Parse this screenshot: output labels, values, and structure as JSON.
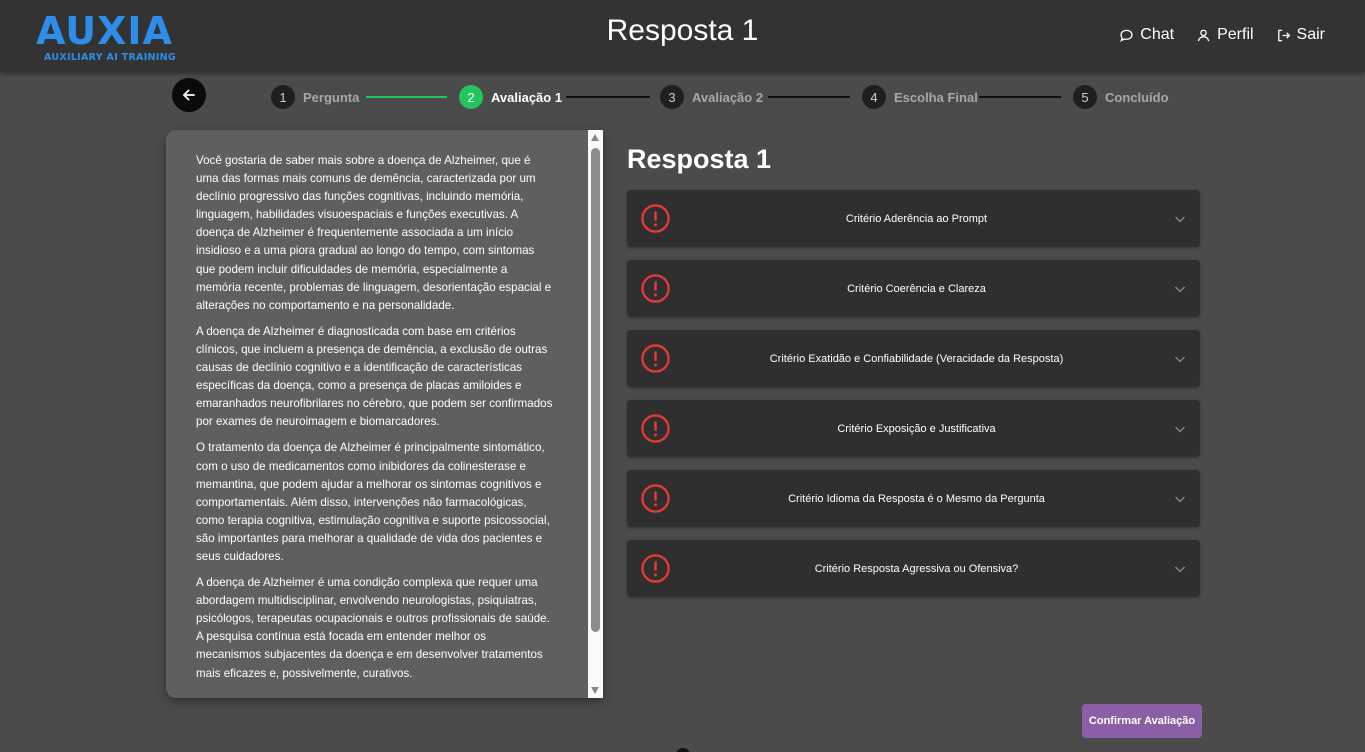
{
  "header": {
    "logo_main": "AUXIA",
    "logo_sub": "AUXILIARY AI TRAINING",
    "title": "Resposta 1",
    "nav": [
      {
        "label": "Chat",
        "icon": "chat-bubble-icon"
      },
      {
        "label": "Perfil",
        "icon": "user-icon"
      },
      {
        "label": "Sair",
        "icon": "logout-icon"
      }
    ]
  },
  "stepper": {
    "steps": [
      {
        "num": "1",
        "label": "Pergunta",
        "state": "done"
      },
      {
        "num": "2",
        "label": "Avaliação 1",
        "state": "active"
      },
      {
        "num": "3",
        "label": "Avaliação 2",
        "state": "pending"
      },
      {
        "num": "4",
        "label": "Escolha Final",
        "state": "pending"
      },
      {
        "num": "5",
        "label": "Concluído",
        "state": "pending"
      }
    ],
    "colors": {
      "done": "#22c55e",
      "pending": "#111111"
    }
  },
  "answer": {
    "paragraphs": [
      "Você gostaria de saber mais sobre a doença de Alzheimer, que é uma das formas mais comuns de demência, caracterizada por um declínio progressivo das funções cognitivas, incluindo memória, linguagem, habilidades visuoespaciais e funções executivas. A doença de Alzheimer é frequentemente associada a um início insidioso e a uma piora gradual ao longo do tempo, com sintomas que podem incluir dificuldades de memória, especialmente a memória recente, problemas de linguagem, desorientação espacial e alterações no comportamento e na personalidade.",
      "A doença de Alzheimer é diagnosticada com base em critérios clínicos, que incluem a presença de demência, a exclusão de outras causas de declínio cognitivo e a identificação de características específicas da doença, como a presença de placas amiloides e emaranhados neurofibrilares no cérebro, que podem ser confirmados por exames de neuroimagem e biomarcadores.",
      "O tratamento da doença de Alzheimer é principalmente sintomático, com o uso de medicamentos como inibidores da colinesterase e memantina, que podem ajudar a melhorar os sintomas cognitivos e comportamentais. Além disso, intervenções não farmacológicas, como terapia cognitiva, estimulação cognitiva e suporte psicossocial, são importantes para melhorar a qualidade de vida dos pacientes e seus cuidadores.",
      "A doença de Alzheimer é uma condição complexa que requer uma abordagem multidisciplinar, envolvendo neurologistas, psiquiatras, psicólogos, terapeutas ocupacionais e outros profissionais de saúde. A pesquisa contínua está focada em entender melhor os mecanismos subjacentes da doença e em desenvolver tratamentos mais eficazes e, possivelmente, curativos."
    ]
  },
  "evaluation": {
    "title": "Resposta 1",
    "criteria": [
      {
        "label": "Critério Aderência ao Prompt",
        "status_icon": "alert-circle-icon"
      },
      {
        "label": "Critério Coerência e Clareza",
        "status_icon": "alert-circle-icon"
      },
      {
        "label": "Critério Exatidão e Confiabilidade (Veracidade da Resposta)",
        "status_icon": "alert-circle-icon"
      },
      {
        "label": "Critério Exposição e Justificativa",
        "status_icon": "alert-circle-icon"
      },
      {
        "label": "Critério Idioma da Resposta é o Mesmo da Pergunta",
        "status_icon": "alert-circle-icon"
      },
      {
        "label": "Critério Resposta Agressiva ou Ofensiva?",
        "status_icon": "alert-circle-icon"
      }
    ],
    "alert_color": "#e53935",
    "confirm_label": "Confirmar Avaliação",
    "confirm_color": "#8b5fa6"
  }
}
